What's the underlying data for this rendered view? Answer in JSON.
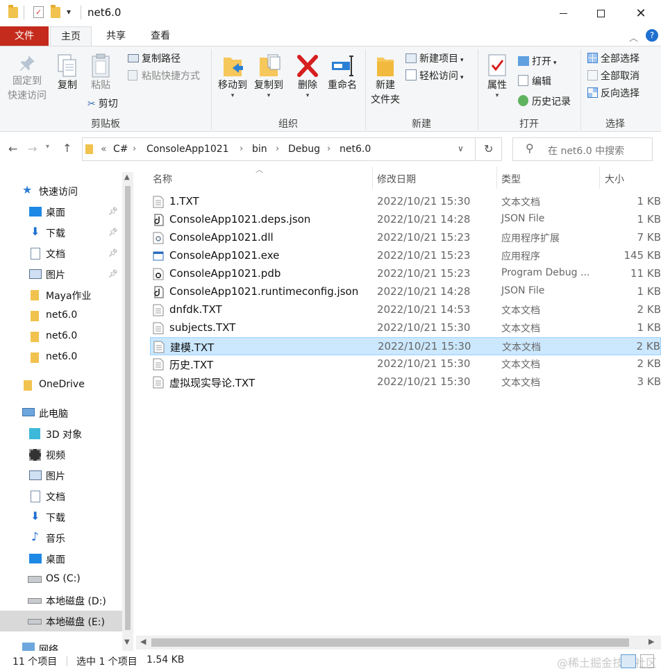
{
  "window": {
    "title": "net6.0",
    "qat_dropdown": "▾"
  },
  "tabs": [
    "文件",
    "主页",
    "共享",
    "查看"
  ],
  "ribbon": {
    "clipboard": {
      "pin_quick": "固定到快速访问",
      "pin_line1": "固定到",
      "pin_line2": "快速访问",
      "copy": "复制",
      "paste": "粘贴",
      "copy_path": "复制路径",
      "paste_shortcut": "粘贴快捷方式",
      "cut": "剪切",
      "label": "剪贴板"
    },
    "organize": {
      "move_to": "移动到",
      "copy_to": "复制到",
      "delete": "删除",
      "rename": "重命名",
      "label": "组织"
    },
    "new": {
      "new_folder_1": "新建",
      "new_folder_2": "文件夹",
      "new_item": "新建项目",
      "easy_access": "轻松访问",
      "label": "新建"
    },
    "open": {
      "properties": "属性",
      "open": "打开",
      "edit": "编辑",
      "history": "历史记录",
      "label": "打开"
    },
    "select": {
      "select_all": "全部选择",
      "select_none": "全部取消",
      "invert": "反向选择",
      "label": "选择"
    }
  },
  "address": {
    "overflow": "«",
    "crumbs": [
      "C#",
      "ConsoleApp1021",
      "bin",
      "Debug",
      "net6.0"
    ],
    "search_placeholder": "在 net6.0 中搜索"
  },
  "nav": {
    "quick_access": "快速访问",
    "items": [
      {
        "label": "桌面",
        "pinned": true
      },
      {
        "label": "下载",
        "pinned": true
      },
      {
        "label": "文档",
        "pinned": true
      },
      {
        "label": "图片",
        "pinned": true
      },
      {
        "label": "Maya作业"
      },
      {
        "label": "net6.0"
      },
      {
        "label": "net6.0"
      },
      {
        "label": "net6.0"
      }
    ],
    "onedrive": "OneDrive",
    "this_pc": "此电脑",
    "pc_items": [
      "3D 对象",
      "视频",
      "图片",
      "文档",
      "下载",
      "音乐",
      "桌面",
      "OS (C:)",
      "本地磁盘 (D:)",
      "本地磁盘 (E:)"
    ],
    "network": "网络"
  },
  "columns": {
    "name": "名称",
    "date": "修改日期",
    "type": "类型",
    "size": "大小"
  },
  "files": [
    {
      "name": "1.TXT",
      "date": "2022/10/21 15:30",
      "type": "文本文档",
      "size": "1 KB",
      "icon": "text-file-icon"
    },
    {
      "name": "ConsoleApp1021.deps.json",
      "date": "2022/10/21 14:28",
      "type": "JSON File",
      "size": "1 KB",
      "icon": "json-file-icon"
    },
    {
      "name": "ConsoleApp1021.dll",
      "date": "2022/10/21 15:23",
      "type": "应用程序扩展",
      "size": "7 KB",
      "icon": "dll-file-icon"
    },
    {
      "name": "ConsoleApp1021.exe",
      "date": "2022/10/21 15:23",
      "type": "应用程序",
      "size": "145 KB",
      "icon": "exe-file-icon"
    },
    {
      "name": "ConsoleApp1021.pdb",
      "date": "2022/10/21 15:23",
      "type": "Program Debug ...",
      "size": "11 KB",
      "icon": "pdb-file-icon"
    },
    {
      "name": "ConsoleApp1021.runtimeconfig.json",
      "date": "2022/10/21 14:28",
      "type": "JSON File",
      "size": "1 KB",
      "icon": "json-file-icon"
    },
    {
      "name": "dnfdk.TXT",
      "date": "2022/10/21 14:53",
      "type": "文本文档",
      "size": "2 KB",
      "icon": "text-file-icon"
    },
    {
      "name": "subjects.TXT",
      "date": "2022/10/21 15:30",
      "type": "文本文档",
      "size": "1 KB",
      "icon": "text-file-icon"
    },
    {
      "name": "建模.TXT",
      "date": "2022/10/21 15:30",
      "type": "文本文档",
      "size": "2 KB",
      "icon": "text-file-icon",
      "selected": true
    },
    {
      "name": "历史.TXT",
      "date": "2022/10/21 15:30",
      "type": "文本文档",
      "size": "2 KB",
      "icon": "text-file-icon"
    },
    {
      "name": "虚拟现实导论.TXT",
      "date": "2022/10/21 15:30",
      "type": "文本文档",
      "size": "3 KB",
      "icon": "text-file-icon"
    }
  ],
  "status": {
    "count": "11 个项目",
    "selected": "选中 1 个项目",
    "size": "1.54 KB",
    "watermark": "@稀土掘金技术社区"
  },
  "colors": {
    "file_tab": "#c42b1c",
    "selection": "#cce8ff",
    "selection_border": "#99d1ff",
    "ribbon_bg": "#f5f6f7"
  }
}
